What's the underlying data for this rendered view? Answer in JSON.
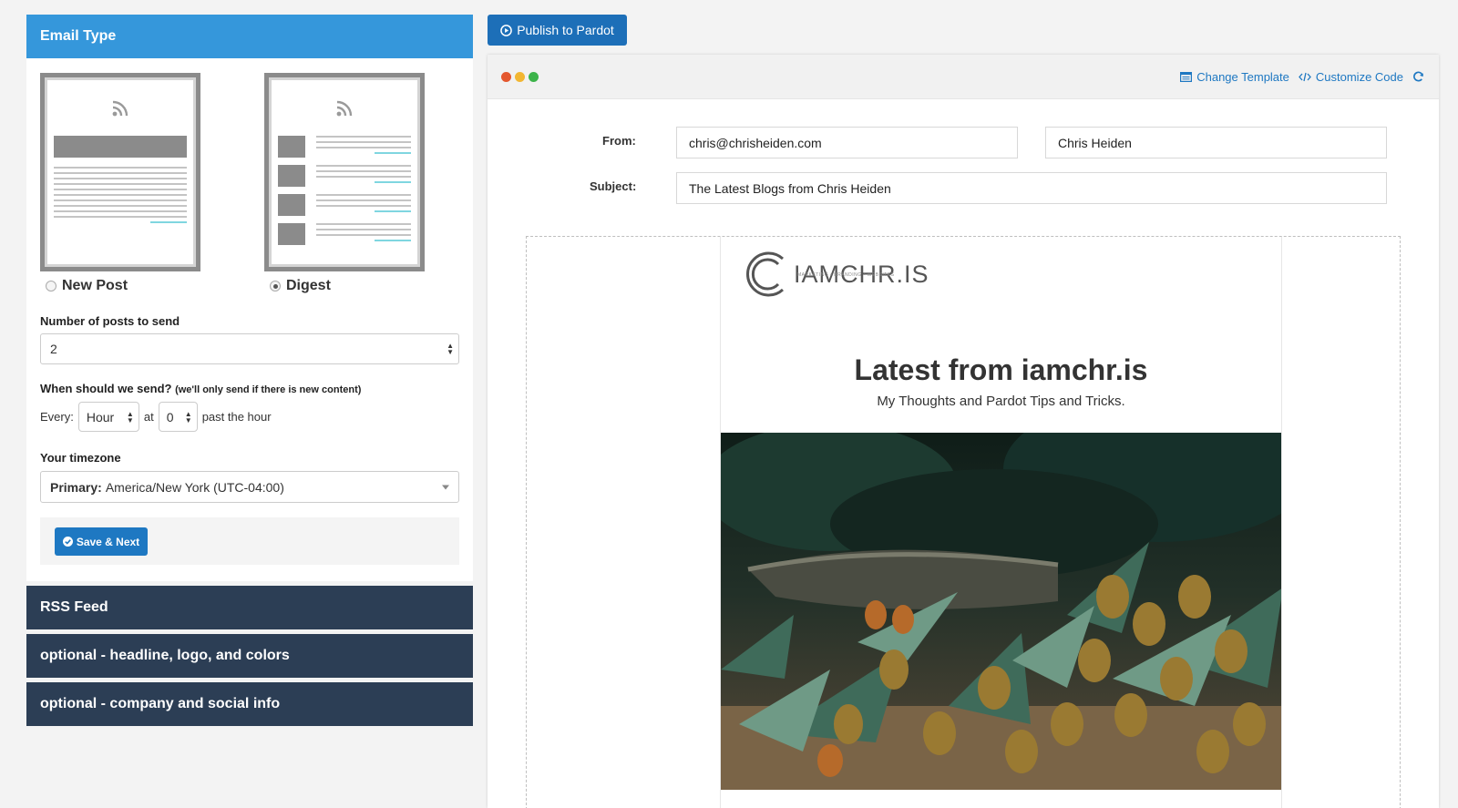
{
  "left": {
    "email_type": {
      "heading": "Email Type",
      "options": [
        {
          "label": "New Post",
          "selected": false
        },
        {
          "label": "Digest",
          "selected": true
        }
      ]
    },
    "posts": {
      "label": "Number of posts to send",
      "value": "2"
    },
    "when": {
      "label": "When should we send?",
      "note": "(we'll only send if there is new content)",
      "every_label": "Every:",
      "interval": "Hour",
      "at_label": "at",
      "minute": "0",
      "suffix": "past the hour"
    },
    "timezone": {
      "label": "Your timezone",
      "prefix": "Primary:",
      "value": "America/New York (UTC-04:00)"
    },
    "save_label": "Save & Next",
    "sections": [
      "RSS Feed",
      "optional - headline, logo, and colors",
      "optional - company and social info"
    ]
  },
  "toolbar": {
    "publish_label": "Publish to Pardot",
    "change_template": "Change Template",
    "customize_code": "Customize Code"
  },
  "header": {
    "from_label": "From:",
    "from_email": "chris@chrisheiden.com",
    "from_name": "Chris Heiden",
    "subject_label": "Subject:",
    "subject": "The Latest Blogs from Chris Heiden"
  },
  "email": {
    "logo_text": "IAMCHR.IS",
    "logo_tagline": "MARKETING • BRANDING • WEBSITES",
    "title": "Latest from iamchr.is",
    "subtitle": "My Thoughts and Pardot Tips and Tricks."
  },
  "colors": {
    "accent_blue": "#3597db",
    "dark_section": "#2c3e55",
    "button_blue": "#1e78c2",
    "dot_red": "#e4572e",
    "dot_yellow": "#f2b632",
    "dot_green": "#3cb34a"
  },
  "icons": {
    "publish": "play-circle-icon",
    "save": "check-circle-icon",
    "change_template": "template-icon",
    "customize_code": "code-icon",
    "refresh": "refresh-icon",
    "rss": "rss-icon"
  }
}
